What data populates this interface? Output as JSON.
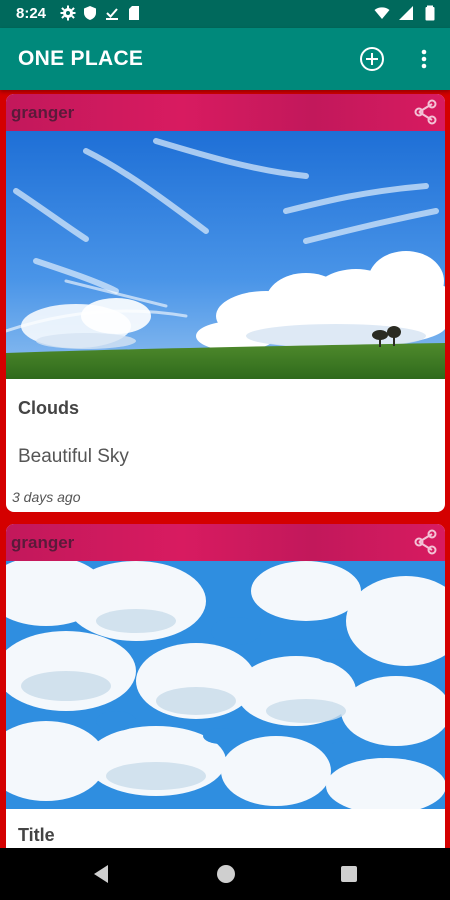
{
  "status_bar": {
    "time": "8:24",
    "left_icons": [
      "gear-icon",
      "shield-icon",
      "download-done-icon",
      "sd-card-icon"
    ],
    "right_icons": [
      "wifi-icon",
      "signal-icon",
      "battery-icon"
    ]
  },
  "app_bar": {
    "title": "ONE PLACE",
    "add_icon": "add-circle-icon",
    "menu_icon": "more-vert-icon",
    "color": "#00897b",
    "status_color": "#00695c"
  },
  "feed": {
    "background_color": "#d40000",
    "header_color": "#d81b60",
    "posts": [
      {
        "user": "granger",
        "image": "sky-over-green-field-photo",
        "title": "Clouds",
        "description": "Beautiful Sky",
        "time": "3 days ago"
      },
      {
        "user": "granger",
        "image": "cumulus-clouds-blue-sky-photo",
        "title": "Title"
      }
    ]
  },
  "nav_bar": {
    "icons": [
      "back-icon",
      "home-icon",
      "recents-icon"
    ]
  }
}
